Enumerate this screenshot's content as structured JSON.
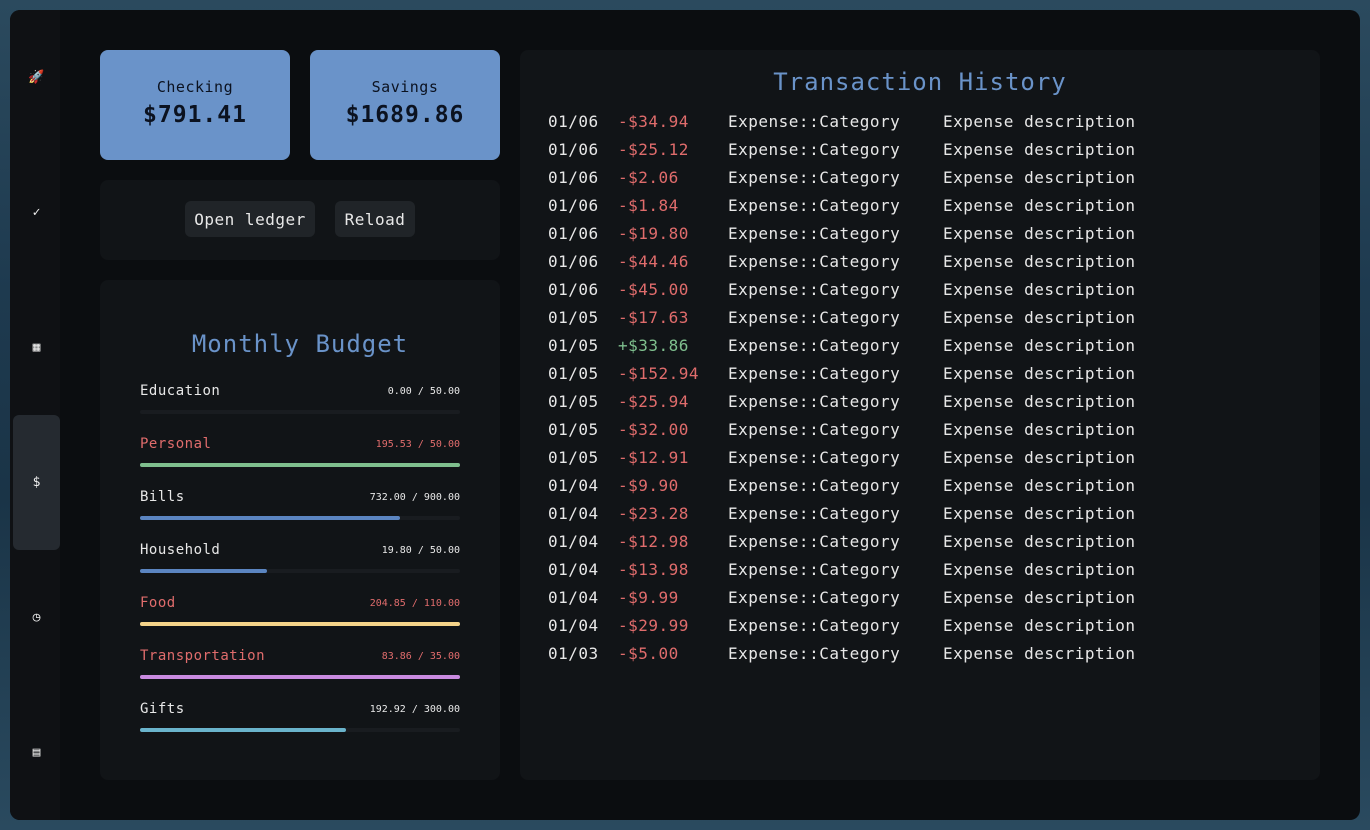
{
  "sidebar": {
    "items": [
      {
        "icon": "rocket-icon",
        "glyph": "🚀"
      },
      {
        "icon": "check-circle-icon",
        "glyph": "✓"
      },
      {
        "icon": "calendar-icon",
        "glyph": "▦"
      },
      {
        "icon": "dollar-icon",
        "glyph": "$"
      },
      {
        "icon": "clock-icon",
        "glyph": "◷"
      },
      {
        "icon": "book-icon",
        "glyph": "▤"
      }
    ]
  },
  "accounts": {
    "checking": {
      "label": "Checking",
      "amount": "$791.41"
    },
    "savings": {
      "label": "Savings",
      "amount": "$1689.86"
    }
  },
  "actions": {
    "open_ledger": "Open ledger",
    "reload": "Reload"
  },
  "budget": {
    "title": "Monthly Budget",
    "rows": [
      {
        "name": "Education",
        "value": "0.00 / 50.00",
        "fraction": 0,
        "color": "#6a93c9",
        "over": false
      },
      {
        "name": "Personal",
        "value": "195.53 / 50.00",
        "fraction": 1,
        "color": "#7fbf8e",
        "over": true
      },
      {
        "name": "Bills",
        "value": "732.00 / 900.00",
        "fraction": 0.813,
        "color": "#5b85c1",
        "over": false
      },
      {
        "name": "Household",
        "value": "19.80 / 50.00",
        "fraction": 0.396,
        "color": "#5b85c1",
        "over": false
      },
      {
        "name": "Food",
        "value": "204.85 / 110.00",
        "fraction": 1,
        "color": "#f5d48a",
        "over": true
      },
      {
        "name": "Transportation",
        "value": "83.86 / 35.00",
        "fraction": 1,
        "color": "#c98ae0",
        "over": true
      },
      {
        "name": "Gifts",
        "value": "192.92 / 300.00",
        "fraction": 0.643,
        "color": "#6ab4cc",
        "over": false
      }
    ]
  },
  "history": {
    "title": "Transaction History",
    "rows": [
      {
        "date": "01/06",
        "amount": "-$34.94",
        "category": "Expense::Category",
        "description": "Expense description"
      },
      {
        "date": "01/06",
        "amount": "-$25.12",
        "category": "Expense::Category",
        "description": "Expense description"
      },
      {
        "date": "01/06",
        "amount": "-$2.06",
        "category": "Expense::Category",
        "description": "Expense description"
      },
      {
        "date": "01/06",
        "amount": "-$1.84",
        "category": "Expense::Category",
        "description": "Expense description"
      },
      {
        "date": "01/06",
        "amount": "-$19.80",
        "category": "Expense::Category",
        "description": "Expense description"
      },
      {
        "date": "01/06",
        "amount": "-$44.46",
        "category": "Expense::Category",
        "description": "Expense description"
      },
      {
        "date": "01/06",
        "amount": "-$45.00",
        "category": "Expense::Category",
        "description": "Expense description"
      },
      {
        "date": "01/05",
        "amount": "-$17.63",
        "category": "Expense::Category",
        "description": "Expense description"
      },
      {
        "date": "01/05",
        "amount": "+$33.86",
        "category": "Expense::Category",
        "description": "Expense description"
      },
      {
        "date": "01/05",
        "amount": "-$152.94",
        "category": "Expense::Category",
        "description": "Expense description"
      },
      {
        "date": "01/05",
        "amount": "-$25.94",
        "category": "Expense::Category",
        "description": "Expense description"
      },
      {
        "date": "01/05",
        "amount": "-$32.00",
        "category": "Expense::Category",
        "description": "Expense description"
      },
      {
        "date": "01/05",
        "amount": "-$12.91",
        "category": "Expense::Category",
        "description": "Expense description"
      },
      {
        "date": "01/04",
        "amount": "-$9.90",
        "category": "Expense::Category",
        "description": "Expense description"
      },
      {
        "date": "01/04",
        "amount": "-$23.28",
        "category": "Expense::Category",
        "description": "Expense description"
      },
      {
        "date": "01/04",
        "amount": "-$12.98",
        "category": "Expense::Category",
        "description": "Expense description"
      },
      {
        "date": "01/04",
        "amount": "-$13.98",
        "category": "Expense::Category",
        "description": "Expense description"
      },
      {
        "date": "01/04",
        "amount": "-$9.99",
        "category": "Expense::Category",
        "description": "Expense description"
      },
      {
        "date": "01/04",
        "amount": "-$29.99",
        "category": "Expense::Category",
        "description": "Expense description"
      },
      {
        "date": "01/03",
        "amount": "-$5.00",
        "category": "Expense::Category",
        "description": "Expense description"
      }
    ]
  }
}
